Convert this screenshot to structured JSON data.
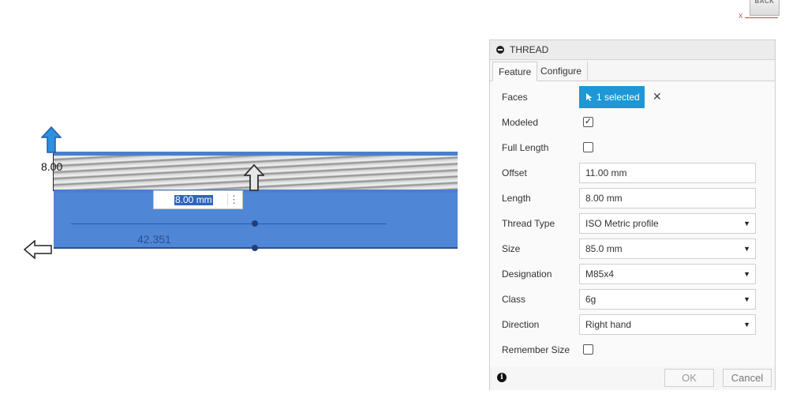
{
  "viewcube": {
    "face_label": "BACK",
    "axis_label": "X"
  },
  "canvas": {
    "dim_length": "42.351",
    "dim_height": "8.00",
    "input_value": "8.00 mm"
  },
  "dialog": {
    "title": "THREAD",
    "tabs": [
      "Feature",
      "Configure"
    ],
    "rows": {
      "faces_label": "Faces",
      "faces_value": "1 selected",
      "modeled_label": "Modeled",
      "modeled_checked": true,
      "full_length_label": "Full Length",
      "full_length_checked": false,
      "offset_label": "Offset",
      "offset_value": "11.00 mm",
      "length_label": "Length",
      "length_value": "8.00 mm",
      "thread_type_label": "Thread Type",
      "thread_type_value": "ISO Metric profile",
      "size_label": "Size",
      "size_value": "85.0 mm",
      "designation_label": "Designation",
      "designation_value": "M85x4",
      "class_label": "Class",
      "class_value": "6g",
      "direction_label": "Direction",
      "direction_value": "Right hand",
      "remember_size_label": "Remember Size",
      "remember_size_checked": false
    },
    "footer": {
      "ok_label": "OK",
      "cancel_label": "Cancel"
    }
  },
  "colors": {
    "accent": "#1e97d6",
    "model_blue": "#4f86d6",
    "arrow_blue": "#2f8fe0"
  }
}
